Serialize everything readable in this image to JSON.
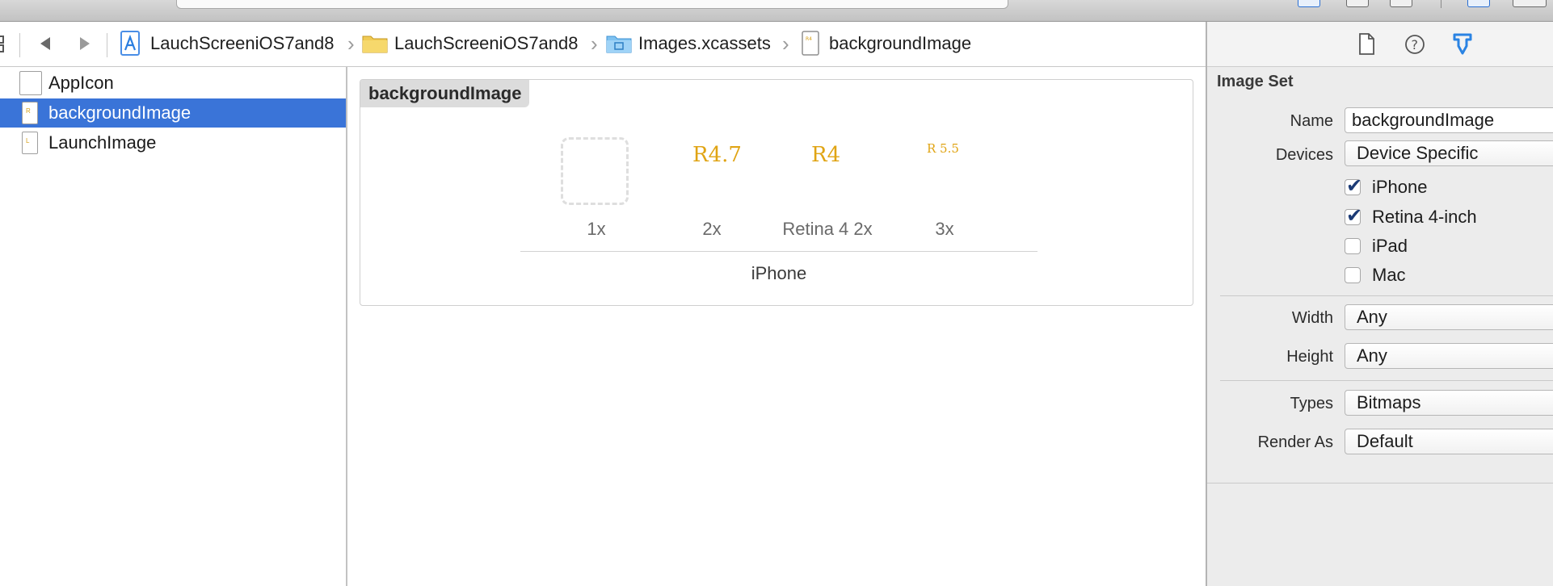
{
  "jumpbar": {
    "project": "LauchScreeniOS7and8",
    "group": "LauchScreeniOS7and8",
    "catalog": "Images.xcassets",
    "asset": "backgroundImage"
  },
  "sidebar": {
    "items": [
      {
        "label": "AppIcon",
        "selected": false
      },
      {
        "label": "backgroundImage",
        "selected": true
      },
      {
        "label": "LaunchImage",
        "selected": false
      }
    ]
  },
  "editor": {
    "set_title": "backgroundImage",
    "slots": [
      {
        "label": "1x",
        "glyph": ""
      },
      {
        "label": "2x",
        "glyph": "R4.7"
      },
      {
        "label": "Retina 4 2x",
        "glyph": "R4"
      },
      {
        "label": "3x",
        "glyph": "R 5.5"
      }
    ],
    "group_label": "iPhone"
  },
  "inspector": {
    "heading": "Image Set",
    "name_label": "Name",
    "name_value": "backgroundImage",
    "devices_label": "Devices",
    "devices_value": "Device Specific",
    "checks": [
      {
        "label": "iPhone",
        "checked": true
      },
      {
        "label": "Retina 4-inch",
        "checked": true
      },
      {
        "label": "iPad",
        "checked": false
      },
      {
        "label": "Mac",
        "checked": false
      }
    ],
    "width_label": "Width",
    "width_value": "Any",
    "height_label": "Height",
    "height_value": "Any",
    "types_label": "Types",
    "types_value": "Bitmaps",
    "render_label": "Render As",
    "render_value": "Default"
  },
  "colors": {
    "selection": "#3a74d8",
    "accent_blue": "#2a83e3",
    "glyph_orange": "#e0a414"
  }
}
